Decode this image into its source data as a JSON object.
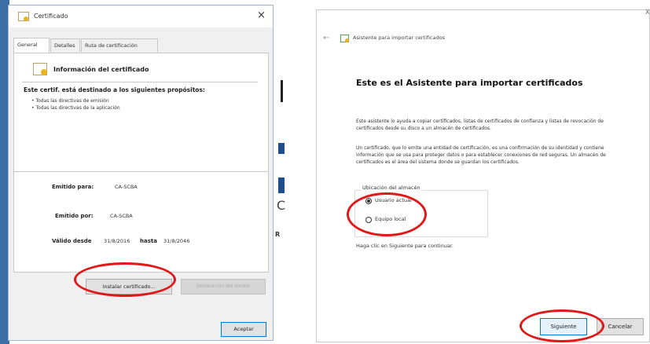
{
  "left_dialog": {
    "title": "Certificado",
    "close_glyph": "×",
    "tabs": [
      {
        "label": "General"
      },
      {
        "label": "Detalles"
      },
      {
        "label": "Ruta de certificación"
      }
    ],
    "info_heading": "Información del certificado",
    "purposes_title": "Este certif. está destinado a los siguientes propósitos:",
    "purposes": [
      "• Todas las directivas de emisión",
      "• Todas las directivas de la aplicación"
    ],
    "issued_to_label": "Emitido para:",
    "issued_to_value": "CA-SCBA",
    "issued_by_label": "Emitido por:",
    "issued_by_value": "CA-SCBA",
    "valid_from_label": "Válido desde",
    "valid_from_value": "31/8/2016",
    "valid_to_label": "hasta",
    "valid_to_value": "31/8/2046",
    "install_button": "Instalar certificado...",
    "issuer_button": "Declaración del emisor",
    "accept_button": "Aceptar"
  },
  "background_fragments": {
    "letter_c": "C",
    "letter_r": "R"
  },
  "right_dialog": {
    "back_glyph": "←",
    "close_glyph": "X",
    "title": "Asistente para importar certificados",
    "heading": "Este es el Asistente para importar certificados",
    "paragraph_1": "Este asistente lo ayuda a copiar certificados, listas de certificados de confianza y listas de revocación de certificados desde su disco a un almacén de certificados.",
    "paragraph_2": "Un certificado, que lo emite una entidad de certificación, es una confirmación de su identidad y contiene información que se usa para proteger datos o para establecer conexiones de red seguras. Un almacén de certificados es el área del sistema donde se guardan los certificados.",
    "store_legend": "Ubicación del almacén",
    "store_options": [
      {
        "label": "Usuario actual",
        "checked": true
      },
      {
        "label": "Equipo local",
        "checked": false
      }
    ],
    "continue_hint": "Haga clic en Siguiente para continuar.",
    "next_button": "Siguiente",
    "cancel_button": "Cancelar"
  },
  "colors": {
    "highlight_ellipse": "#e01818",
    "accent_border": "#0078d7"
  }
}
